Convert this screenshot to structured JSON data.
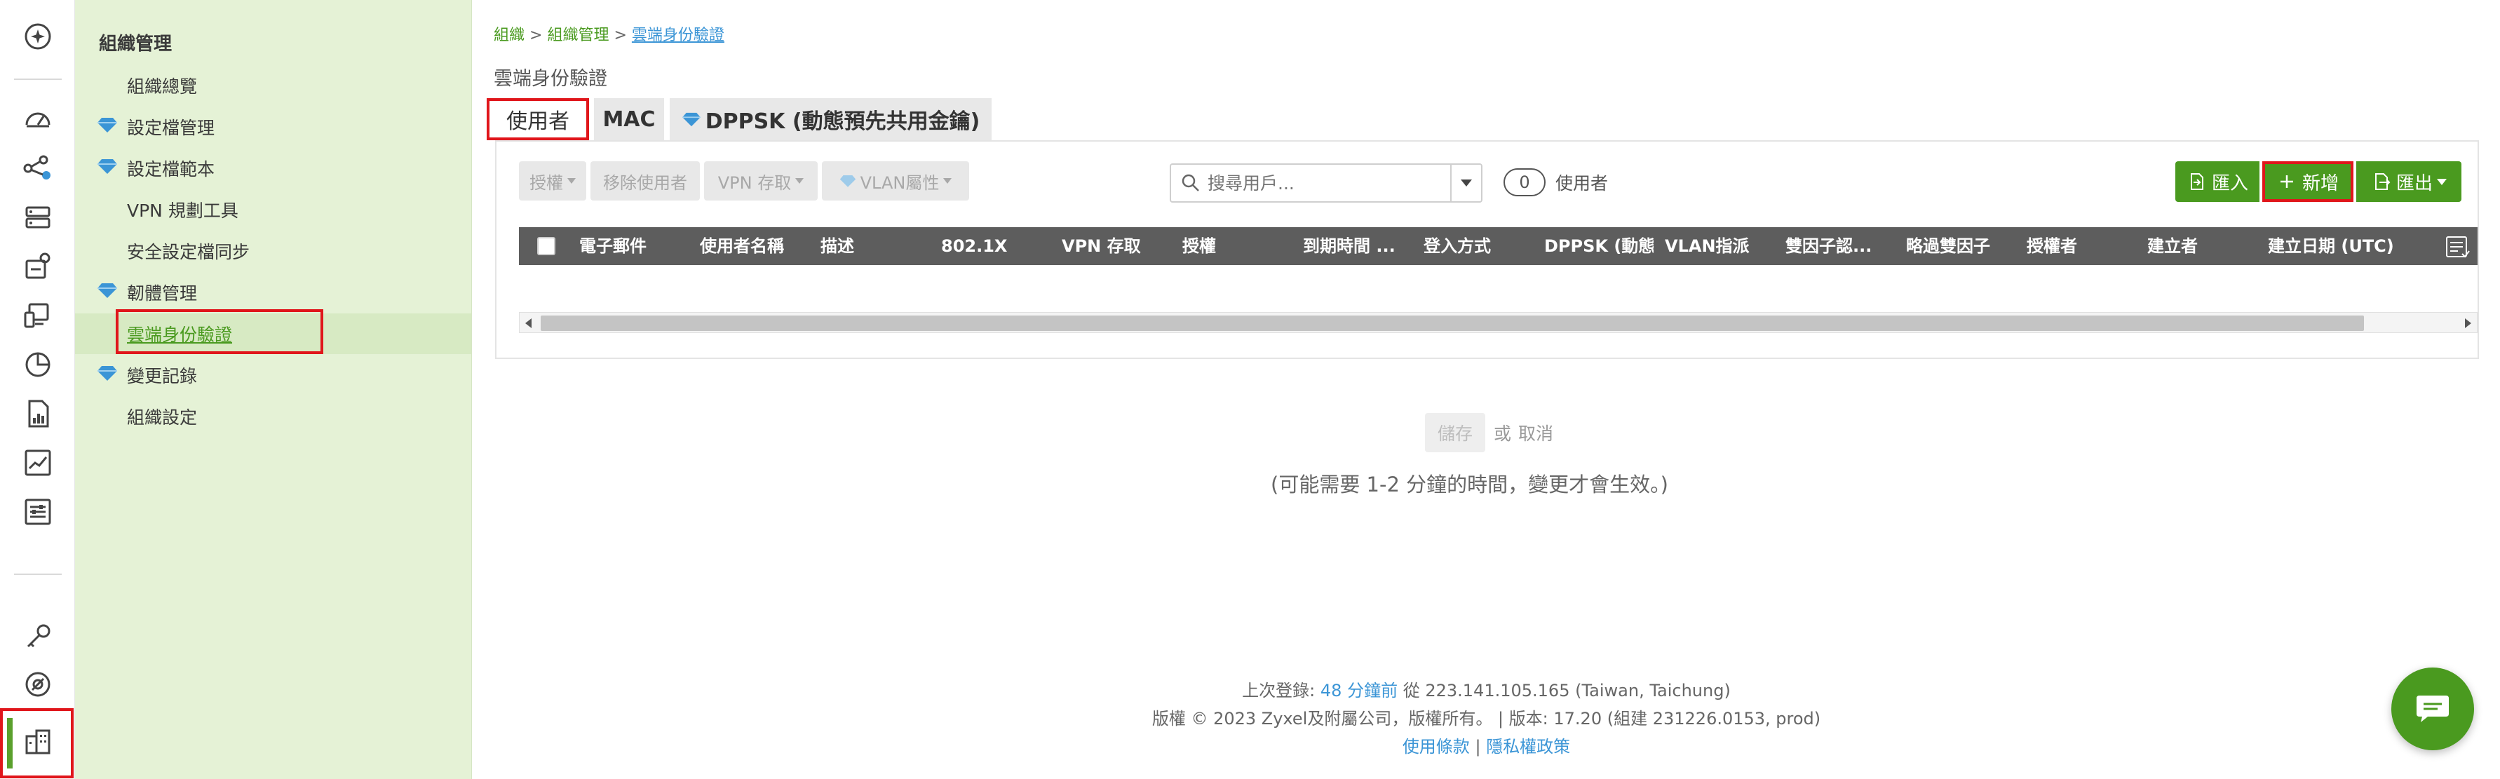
{
  "sidebar_menu": {
    "header": "組織管理",
    "items": [
      {
        "label": "組織總覽",
        "gem": false
      },
      {
        "label": "設定檔管理",
        "gem": true
      },
      {
        "label": "設定檔範本",
        "gem": true
      },
      {
        "label": "VPN 規劃工具",
        "gem": false
      },
      {
        "label": "安全設定檔同步",
        "gem": false
      },
      {
        "label": "韌體管理",
        "gem": true
      },
      {
        "label": "雲端身份驗證",
        "gem": false,
        "active": true
      },
      {
        "label": "變更記錄",
        "gem": true
      },
      {
        "label": "組織設定",
        "gem": false
      }
    ]
  },
  "breadcrumb": {
    "items": [
      "組織",
      "組織管理"
    ],
    "separator": ">",
    "current": "雲端身份驗證"
  },
  "page_title": "雲端身份驗證",
  "tabs": {
    "users": "使用者",
    "mac": "MAC",
    "dppsk": "DPPSK (動態預先共用金鑰)"
  },
  "toolbar": {
    "authorize": "授權",
    "remove_user": "移除使用者",
    "vpn_access": "VPN 存取",
    "vlan_attribute": "VLAN屬性",
    "search_placeholder": "搜尋用戶...",
    "user_count": "0",
    "user_count_label": "使用者",
    "import": "匯入",
    "add": "新增",
    "export": "匯出"
  },
  "table": {
    "columns": [
      "電子郵件",
      "使用者名稱",
      "描述",
      "802.1X",
      "VPN 存取",
      "授權",
      "到期時間 ...",
      "登入方式",
      "DPPSK (動態預",
      "VLAN指派",
      "雙因子認...",
      "略過雙因子",
      "授權者",
      "建立者",
      "建立日期 (UTC)"
    ],
    "rows": []
  },
  "actions": {
    "save": "儲存",
    "or": "或",
    "cancel": "取消",
    "note": "(可能需要 1-2 分鐘的時間，變更才會生效。)"
  },
  "footer": {
    "last_login_label": "上次登錄:",
    "last_login_time": "48 分鐘前",
    "from_text": "從 223.141.105.165 (Taiwan, Taichung)",
    "copyright": "版權 © 2023 Zyxel及附屬公司，版權所有。 | 版本: 17.20 (組建 231226.0153, prod)",
    "terms": "使用條款",
    "divider": "|",
    "privacy": "隱私權政策"
  },
  "colors": {
    "accent_green": "#4a9a1f",
    "side_menu_bg": "#e5f2d6",
    "table_header_bg": "#5d5d5d",
    "highlight_red": "#e0161b",
    "link_blue": "#3b95d6"
  },
  "icons": {
    "rail": [
      "dashboard-star-icon",
      "gauge-icon",
      "topology-icon",
      "server-icon",
      "location-device-icon",
      "monitor-icon",
      "pie-chart-icon",
      "report-icon",
      "line-chart-icon",
      "settings-sliders-icon",
      "key-icon",
      "support-icon",
      "organization-building-icon"
    ],
    "menu_gem": "diamond-icon",
    "search": "search-icon",
    "column_chooser": "column-chooser-icon",
    "chat": "chat-bubble-icon"
  }
}
